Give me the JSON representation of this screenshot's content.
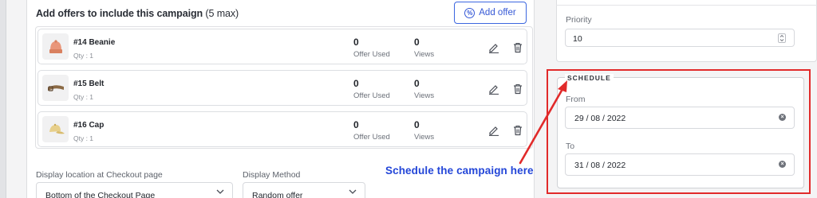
{
  "offers": {
    "title": "Add offers to include this campaign",
    "title_suffix": "(5 max)",
    "add_button_label": "Add offer",
    "items": [
      {
        "name": "#14 Beanie",
        "qty": "Qty : 1",
        "offer_used": "0",
        "offer_used_label": "Offer Used",
        "views": "0",
        "views_label": "Views",
        "icon": "beanie-thumbnail"
      },
      {
        "name": "#15 Belt",
        "qty": "Qty : 1",
        "offer_used": "0",
        "offer_used_label": "Offer Used",
        "views": "0",
        "views_label": "Views",
        "icon": "belt-thumbnail"
      },
      {
        "name": "#16 Cap",
        "qty": "Qty : 1",
        "offer_used": "0",
        "offer_used_label": "Offer Used",
        "views": "0",
        "views_label": "Views",
        "icon": "cap-thumbnail"
      }
    ]
  },
  "display": {
    "location_label": "Display location at Checkout page",
    "location_value": "Bottom of the Checkout Page",
    "method_label": "Display Method",
    "method_value": "Random offer"
  },
  "priority": {
    "label": "Priority",
    "value": "10"
  },
  "schedule": {
    "legend": "SCHEDULE",
    "from_label": "From",
    "from_value": "29 / 08 / 2022",
    "to_label": "To",
    "to_value": "31 / 08 / 2022"
  },
  "annotation": {
    "text": "Schedule the campaign here"
  },
  "colors": {
    "accent": "#3558d6",
    "annotation_red": "#e12a2a",
    "annotation_blue": "#2346d8"
  }
}
